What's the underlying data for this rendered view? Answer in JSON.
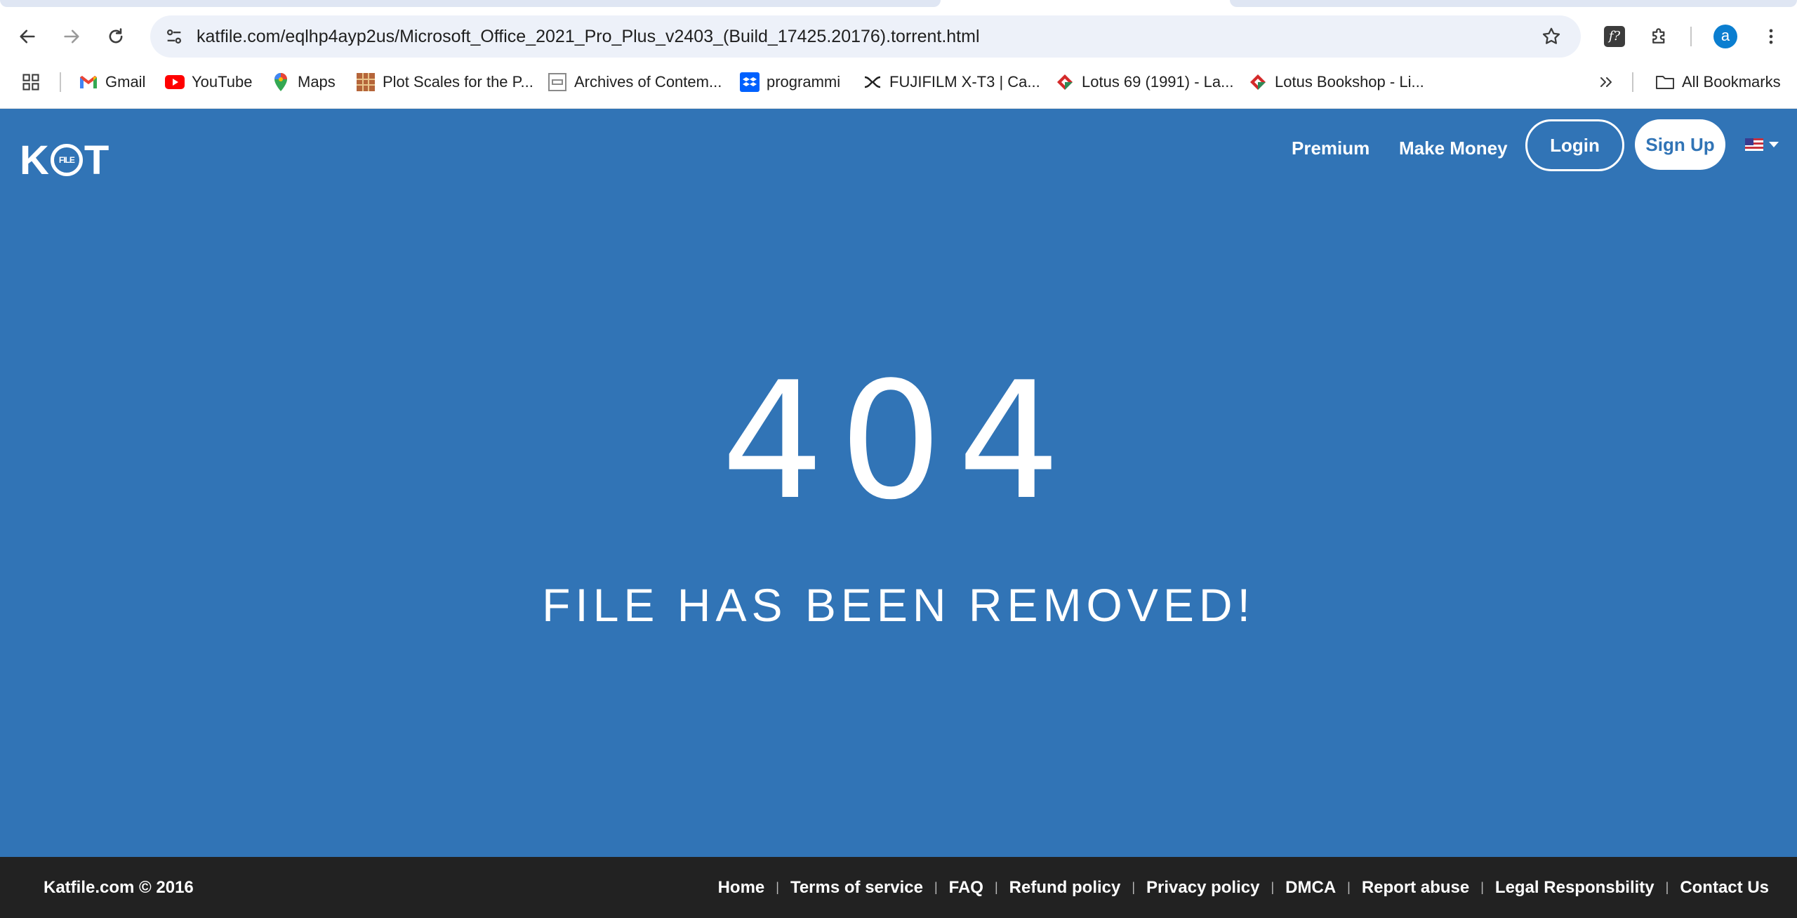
{
  "browser": {
    "url": "katfile.com/eqlhp4ayp2us/Microsoft_Office_2021_Pro_Plus_v2403_(Build_17425.20176).torrent.html",
    "profile_initial": "a",
    "extension_label": "f?",
    "bookmarks": [
      {
        "label": "Gmail",
        "icon": "gmail-icon"
      },
      {
        "label": "YouTube",
        "icon": "youtube-icon"
      },
      {
        "label": "Maps",
        "icon": "maps-icon"
      },
      {
        "label": "Plot Scales for the P...",
        "icon": "plot-scales-icon"
      },
      {
        "label": "Archives of Contem...",
        "icon": "archives-icon"
      },
      {
        "label": "programmi",
        "icon": "dropbox-icon"
      },
      {
        "label": "FUJIFILM X-T3 | Ca...",
        "icon": "fujifilm-icon"
      },
      {
        "label": "Lotus 69 (1991) - La...",
        "icon": "lotus-icon"
      },
      {
        "label": "Lotus Bookshop - Li...",
        "icon": "lotus-icon"
      }
    ],
    "all_bookmarks_label": "All Bookmarks"
  },
  "site": {
    "logo": {
      "left": "K",
      "circle": "FILE",
      "right": "T"
    },
    "nav": {
      "premium": "Premium",
      "make_money": "Make Money",
      "login": "Login",
      "signup": "Sign Up"
    },
    "accent_color": "#3174b6"
  },
  "main": {
    "error_code": "404",
    "message": "FILE HAS BEEN REMOVED!"
  },
  "footer": {
    "copyright": "Katfile.com © 2016",
    "links": [
      "Home",
      "Terms of service",
      "FAQ",
      "Refund policy",
      "Privacy policy",
      "DMCA",
      "Report abuse",
      "Legal Responsbility",
      "Contact Us"
    ]
  }
}
